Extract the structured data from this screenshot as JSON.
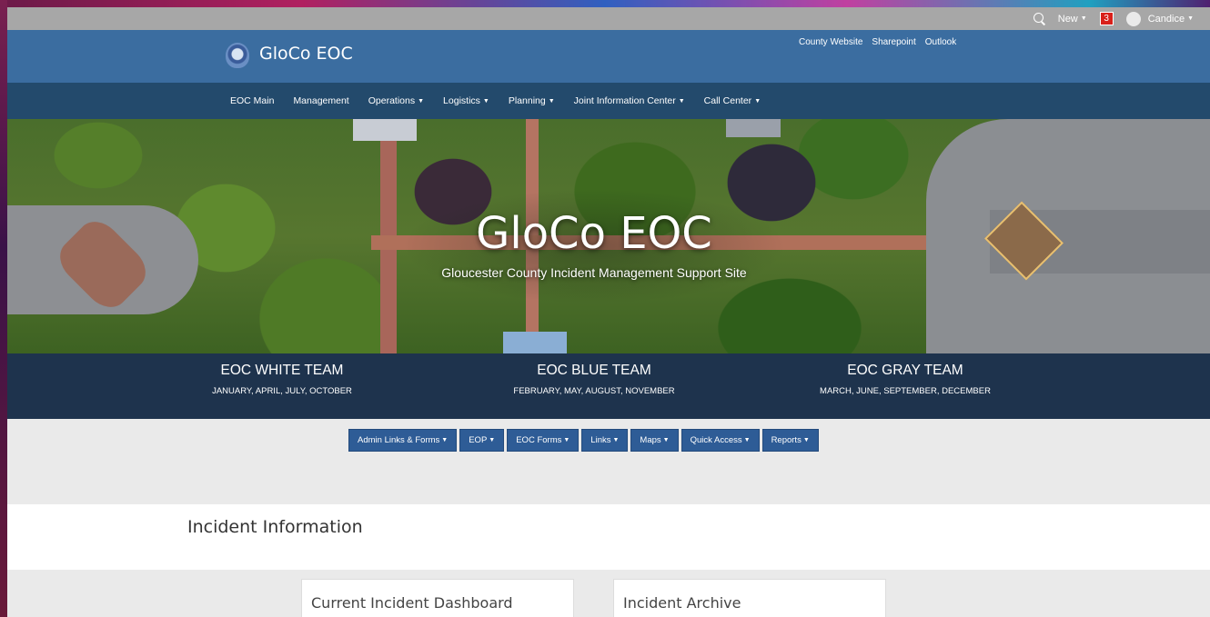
{
  "suite_bar": {
    "new_label": "New",
    "notification_count": "3",
    "user_name": "Candice"
  },
  "brand": {
    "site_title": "GloCo EOC",
    "top_links": [
      "County Website",
      "Sharepoint",
      "Outlook"
    ]
  },
  "nav": {
    "items": [
      {
        "label": "EOC Main",
        "dropdown": false
      },
      {
        "label": "Management",
        "dropdown": false
      },
      {
        "label": "Operations",
        "dropdown": true
      },
      {
        "label": "Logistics",
        "dropdown": true
      },
      {
        "label": "Planning",
        "dropdown": true
      },
      {
        "label": "Joint Information Center",
        "dropdown": true
      },
      {
        "label": "Call Center",
        "dropdown": true
      }
    ]
  },
  "hero": {
    "title": "GloCo EOC",
    "subtitle": "Gloucester County Incident Management Support Site"
  },
  "teams": [
    {
      "name": "EOC WHITE TEAM",
      "months": "JANUARY, APRIL, JULY, OCTOBER"
    },
    {
      "name": "EOC BLUE TEAM",
      "months": "FEBRUARY, MAY, AUGUST, NOVEMBER"
    },
    {
      "name": "EOC GRAY TEAM",
      "months": "MARCH, JUNE, SEPTEMBER, DECEMBER"
    }
  ],
  "quick_buttons": [
    "Admin Links & Forms",
    "EOP",
    "EOC Forms",
    "Links",
    "Maps",
    "Quick Access",
    "Reports"
  ],
  "incident": {
    "section_title": "Incident Information",
    "cards": [
      "Current Incident Dashboard",
      "Incident Archive"
    ]
  },
  "colors": {
    "suite_bar": "#a7a7a7",
    "brand_bar": "#3b6da0",
    "nav_bar": "#234a6c",
    "teams_band": "#1e334d",
    "button": "#2e5c96",
    "notification": "#d8201a"
  }
}
